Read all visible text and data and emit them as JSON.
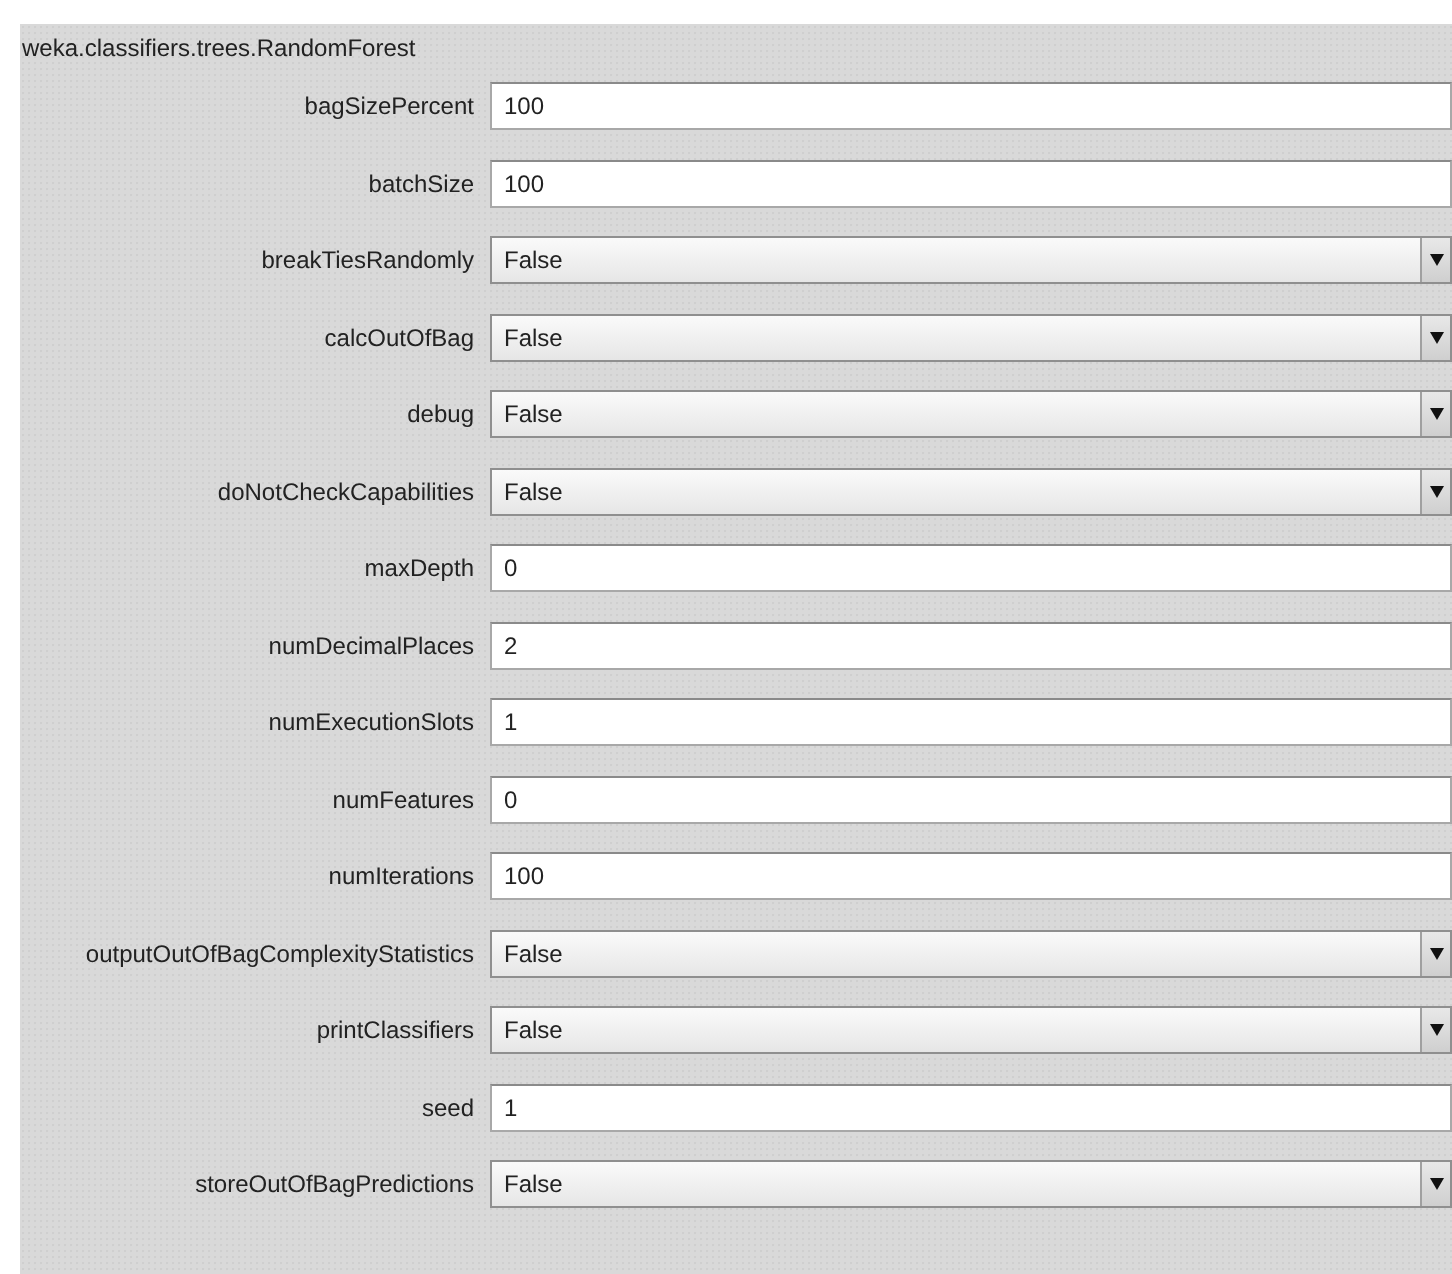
{
  "title": "weka.classifiers.trees.RandomForest",
  "properties": [
    {
      "label": "bagSizePercent",
      "kind": "text",
      "value": "100"
    },
    {
      "label": "batchSize",
      "kind": "text",
      "value": "100"
    },
    {
      "label": "breakTiesRandomly",
      "kind": "choice",
      "value": "False"
    },
    {
      "label": "calcOutOfBag",
      "kind": "choice",
      "value": "False"
    },
    {
      "label": "debug",
      "kind": "choice",
      "value": "False"
    },
    {
      "label": "doNotCheckCapabilities",
      "kind": "choice",
      "value": "False"
    },
    {
      "label": "maxDepth",
      "kind": "text",
      "value": "0"
    },
    {
      "label": "numDecimalPlaces",
      "kind": "text",
      "value": "2"
    },
    {
      "label": "numExecutionSlots",
      "kind": "text",
      "value": "1"
    },
    {
      "label": "numFeatures",
      "kind": "text",
      "value": "0"
    },
    {
      "label": "numIterations",
      "kind": "text",
      "value": "100"
    },
    {
      "label": "outputOutOfBagComplexityStatistics",
      "kind": "choice",
      "value": "False"
    },
    {
      "label": "printClassifiers",
      "kind": "choice",
      "value": "False"
    },
    {
      "label": "seed",
      "kind": "text",
      "value": "1"
    },
    {
      "label": "storeOutOfBagPredictions",
      "kind": "choice",
      "value": "False"
    }
  ]
}
